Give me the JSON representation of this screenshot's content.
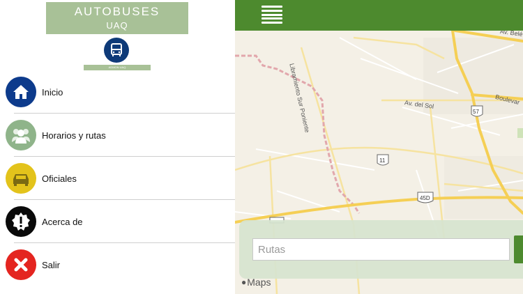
{
  "app": {
    "logo_line1": "AUTOBUSES",
    "logo_line2": "UAQ",
    "logo_strip_text": "ADMON UAQ"
  },
  "menu": {
    "items": [
      {
        "label": "Inicio",
        "icon": "home-icon",
        "color": "#0d3b8c"
      },
      {
        "label": "Horarios y rutas",
        "icon": "people-icon",
        "color": "#8fb48a"
      },
      {
        "label": "Oficiales",
        "icon": "car-icon",
        "color": "#e3c31b"
      },
      {
        "label": "Acerca de",
        "icon": "info-badge-icon",
        "color": "#0a0a0a"
      },
      {
        "label": "Salir",
        "icon": "close-icon",
        "color": "#e42520"
      }
    ]
  },
  "topbar": {
    "menu_icon": "hamburger-icon",
    "color": "#4d8a2e"
  },
  "map": {
    "labels": {
      "libramiento": "Libramiento Sur Poniente",
      "av_del_sol": "Av. del Sol",
      "boulevard": "Boulevar",
      "av_bel": "Av. Belé",
      "shield_11": "11",
      "shield_57": "57",
      "shield_45d": "45D"
    },
    "attribution": "Maps"
  },
  "search": {
    "placeholder": "Rutas",
    "value": ""
  },
  "colors": {
    "accent": "#4d8a2e",
    "logo_green": "#a8c197",
    "map_bg": "#f4f0e6"
  }
}
